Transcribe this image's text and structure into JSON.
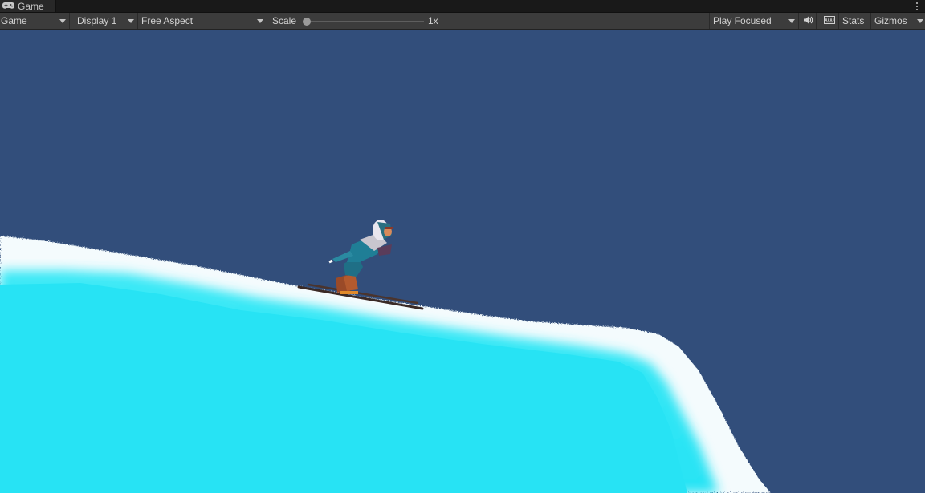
{
  "window": {
    "tab_title": "Game"
  },
  "toolbar": {
    "view_mode": "Game",
    "display": "Display 1",
    "aspect": "Free Aspect",
    "scale_label": "Scale",
    "scale_value": "1x",
    "play_mode": "Play Focused",
    "stats_label": "Stats",
    "gizmos_label": "Gizmos",
    "audio_icon": "speaker-icon",
    "stats_grid_icon": "keyboard-grid-icon"
  },
  "scene": {
    "sky_color": "#324e7b",
    "ice_color": "#2ee6f5",
    "snow_color": "#f4fbfd",
    "subject": "skier"
  }
}
